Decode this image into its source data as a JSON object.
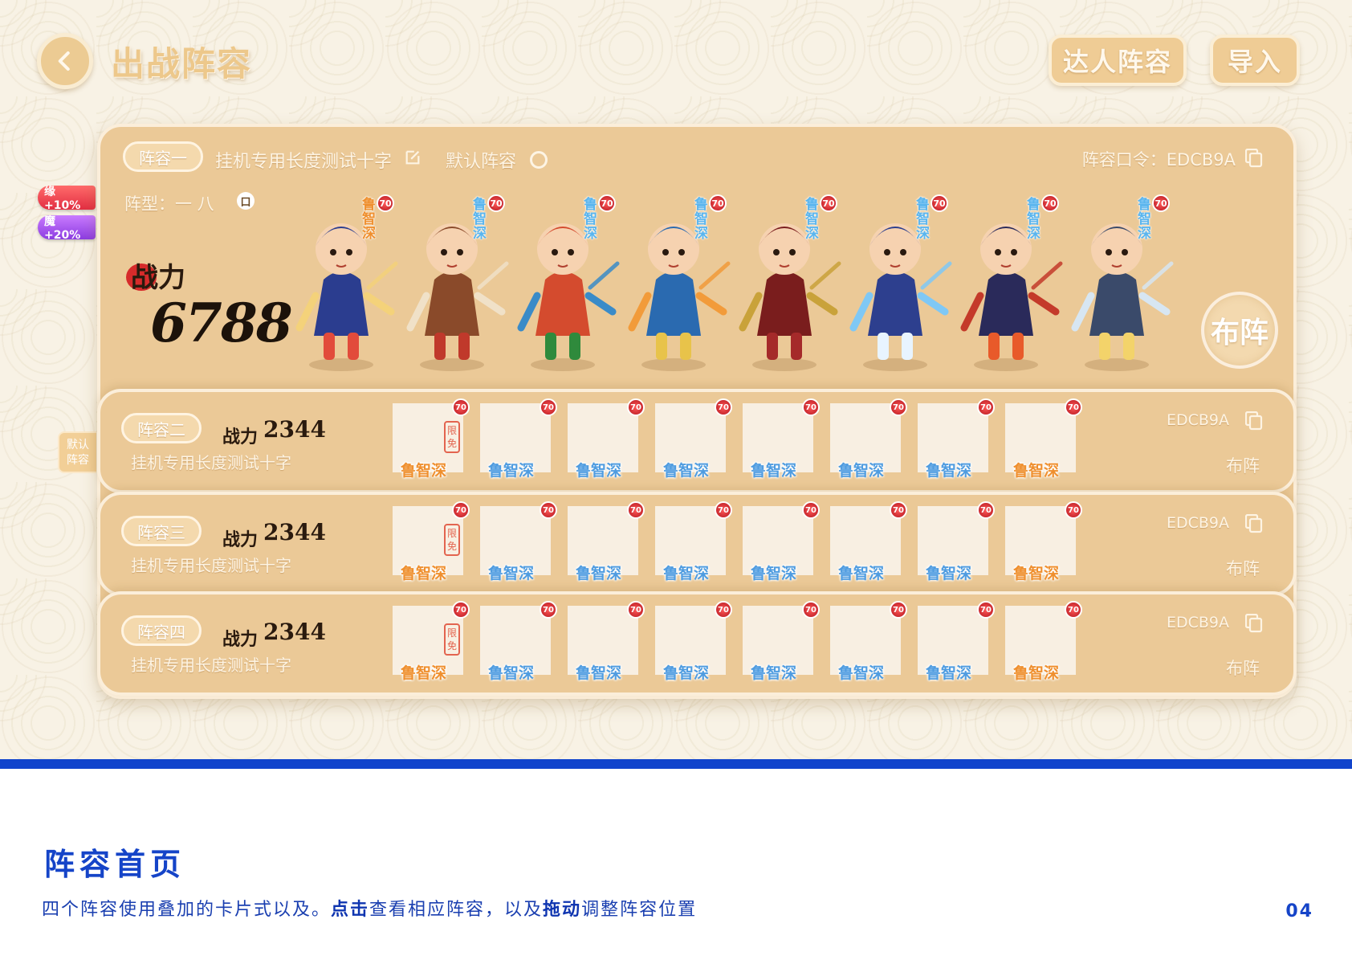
{
  "header": {
    "title": "出战阵容",
    "expert_button": "达人阵容",
    "import_button": "导入"
  },
  "bonuses": {
    "yuan": "缘 +10%",
    "mo": "魔 +20%"
  },
  "default_side_tag": "默认\n阵容",
  "lineup_one": {
    "tag": "阵容一",
    "name": "挂机专用长度测试十字",
    "default_label": "默认阵容",
    "code_label": "阵容口令：EDCB9A",
    "formation_label": "阵型：一 八",
    "formation_mark": "口",
    "power_label": "战力",
    "power_value": "6788",
    "buzhen": "布阵",
    "heroes": [
      {
        "name": "鲁智深",
        "level": "70",
        "color": "orange"
      },
      {
        "name": "鲁智深",
        "level": "70",
        "color": "blue"
      },
      {
        "name": "鲁智深",
        "level": "70",
        "color": "blue"
      },
      {
        "name": "鲁智深",
        "level": "70",
        "color": "blue"
      },
      {
        "name": "鲁智深",
        "level": "70",
        "color": "blue"
      },
      {
        "name": "鲁智深",
        "level": "70",
        "color": "blue"
      },
      {
        "name": "鲁智深",
        "level": "70",
        "color": "blue"
      },
      {
        "name": "鲁智深",
        "level": "70",
        "color": "blue"
      }
    ]
  },
  "lineups": [
    {
      "tag": "阵容二",
      "power_label": "战力",
      "power_value": "2344",
      "name": "挂机专用长度测试十字",
      "code": "EDCB9A",
      "buzhen": "布阵",
      "limit_seal": "限免",
      "slots": [
        {
          "name": "鲁智深",
          "level": "70",
          "color": "orange"
        },
        {
          "name": "鲁智深",
          "level": "70",
          "color": "blue"
        },
        {
          "name": "鲁智深",
          "level": "70",
          "color": "blue"
        },
        {
          "name": "鲁智深",
          "level": "70",
          "color": "blue"
        },
        {
          "name": "鲁智深",
          "level": "70",
          "color": "blue"
        },
        {
          "name": "鲁智深",
          "level": "70",
          "color": "blue"
        },
        {
          "name": "鲁智深",
          "level": "70",
          "color": "blue"
        },
        {
          "name": "鲁智深",
          "level": "70",
          "color": "orange"
        }
      ]
    },
    {
      "tag": "阵容三",
      "power_label": "战力",
      "power_value": "2344",
      "name": "挂机专用长度测试十字",
      "code": "EDCB9A",
      "buzhen": "布阵",
      "limit_seal": "限免",
      "slots": [
        {
          "name": "鲁智深",
          "level": "70",
          "color": "orange"
        },
        {
          "name": "鲁智深",
          "level": "70",
          "color": "blue"
        },
        {
          "name": "鲁智深",
          "level": "70",
          "color": "blue"
        },
        {
          "name": "鲁智深",
          "level": "70",
          "color": "blue"
        },
        {
          "name": "鲁智深",
          "level": "70",
          "color": "blue"
        },
        {
          "name": "鲁智深",
          "level": "70",
          "color": "blue"
        },
        {
          "name": "鲁智深",
          "level": "70",
          "color": "blue"
        },
        {
          "name": "鲁智深",
          "level": "70",
          "color": "orange"
        }
      ]
    },
    {
      "tag": "阵容四",
      "power_label": "战力",
      "power_value": "2344",
      "name": "挂机专用长度测试十字",
      "code": "EDCB9A",
      "buzhen": "布阵",
      "limit_seal": "限免",
      "slots": [
        {
          "name": "鲁智深",
          "level": "70",
          "color": "orange"
        },
        {
          "name": "鲁智深",
          "level": "70",
          "color": "blue"
        },
        {
          "name": "鲁智深",
          "level": "70",
          "color": "blue"
        },
        {
          "name": "鲁智深",
          "level": "70",
          "color": "blue"
        },
        {
          "name": "鲁智深",
          "level": "70",
          "color": "blue"
        },
        {
          "name": "鲁智深",
          "level": "70",
          "color": "blue"
        },
        {
          "name": "鲁智深",
          "level": "70",
          "color": "blue"
        },
        {
          "name": "鲁智深",
          "level": "70",
          "color": "orange"
        }
      ]
    }
  ],
  "footer": {
    "title": "阵容首页",
    "desc_part1": "四个阵容使用叠加的卡片式以及。",
    "desc_bold1": "点击",
    "desc_part2": "查看相应阵容，以及",
    "desc_bold2": "拖动",
    "desc_part3": "调整阵容位置",
    "page_number": "04"
  },
  "colors": {
    "panel": "#ebc997",
    "accent_blue": "#1544c8",
    "hero_name_blue": "#4f9ce0",
    "hero_name_orange": "#ef8f2e",
    "level_badge": "#d42020"
  }
}
